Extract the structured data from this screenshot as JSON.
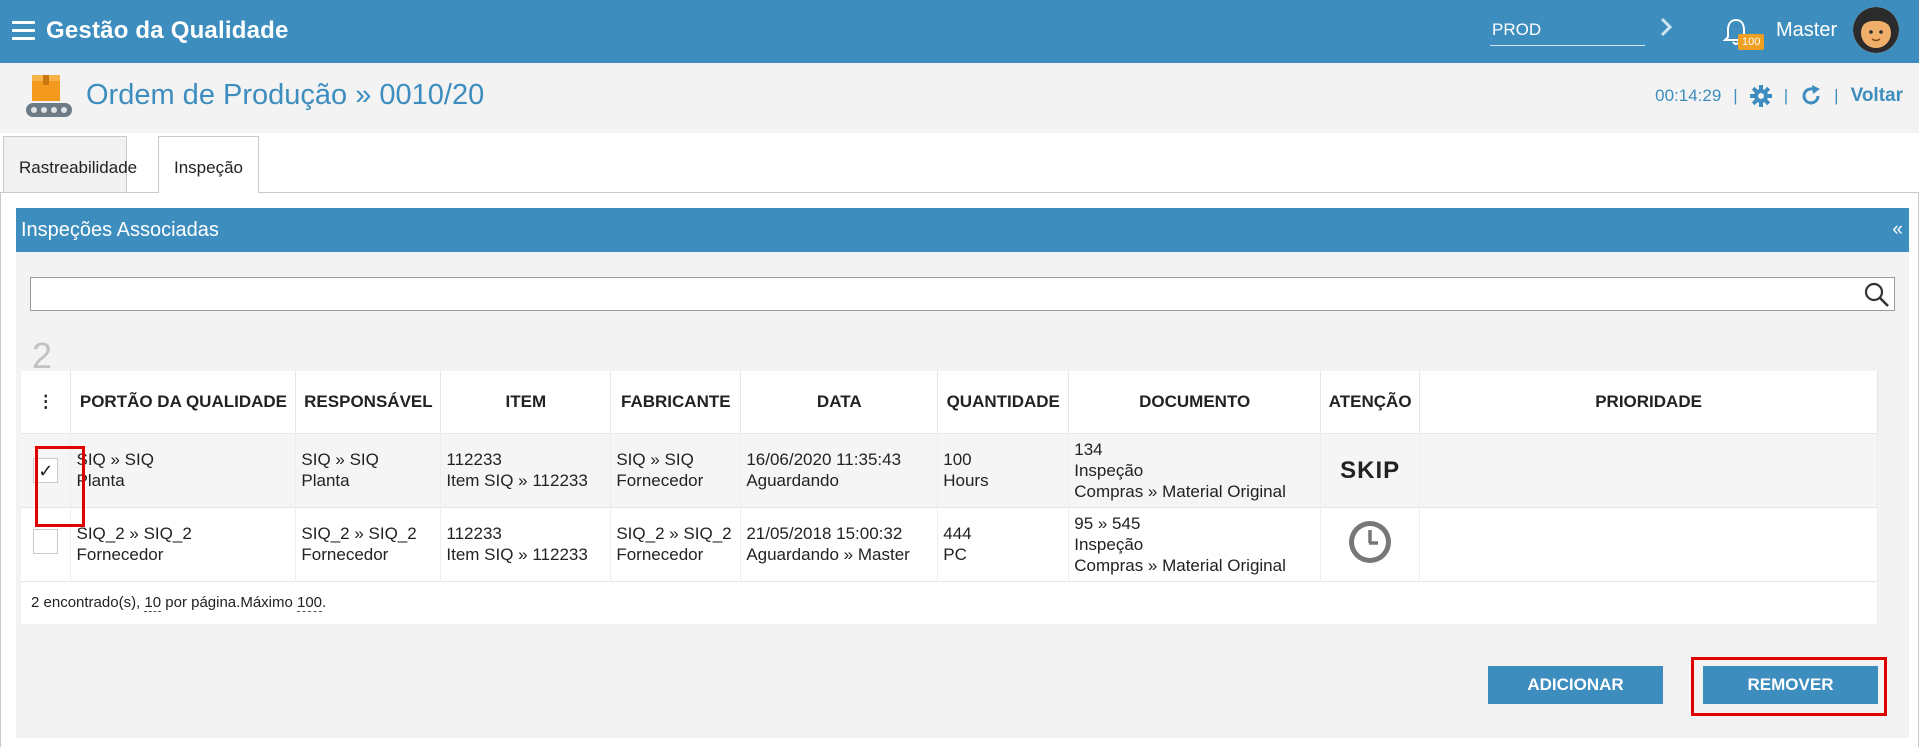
{
  "topbar": {
    "title": "Gestão da Qualidade",
    "env_value": "PROD",
    "notification_count": "100",
    "user_name": "Master"
  },
  "header": {
    "title": "Ordem de Produção » 0010/20",
    "timer": "00:14:29",
    "back_label": "Voltar"
  },
  "tabs": [
    {
      "label": "Rastreabilidade",
      "active": false
    },
    {
      "label": "Inspeção",
      "active": true
    }
  ],
  "panel": {
    "title": "Inspeções Associadas",
    "collapse_symbol": "«",
    "search_value": "",
    "count": "2"
  },
  "table": {
    "menu_symbol": "⋮",
    "columns": [
      "PORTÃO DA QUALIDADE",
      "RESPONSÁVEL",
      "ITEM",
      "FABRICANTE",
      "DATA",
      "QUANTIDADE",
      "DOCUMENTO",
      "ATENÇÃO",
      "PRIORIDADE"
    ],
    "rows": [
      {
        "checked": true,
        "check_mark": "✓",
        "gate": [
          "SIQ » SIQ",
          "Planta"
        ],
        "responsible": [
          "SIQ » SIQ",
          "Planta"
        ],
        "item": [
          "112233",
          "Item SIQ » 112233"
        ],
        "manufacturer": [
          "SIQ » SIQ",
          "Fornecedor"
        ],
        "date": [
          "16/06/2020 11:35:43",
          "Aguardando"
        ],
        "quantity": [
          "100",
          "Hours"
        ],
        "document": [
          "134",
          "Inspeção",
          "Compras » Material Original"
        ],
        "attention": "SKIP",
        "priority": ""
      },
      {
        "checked": false,
        "check_mark": "",
        "gate": [
          "SIQ_2 » SIQ_2",
          "Fornecedor"
        ],
        "responsible": [
          "SIQ_2 » SIQ_2",
          "Fornecedor"
        ],
        "item": [
          "112233",
          "Item SIQ » 112233"
        ],
        "manufacturer": [
          "SIQ_2 » SIQ_2",
          "Fornecedor"
        ],
        "date": [
          "21/05/2018 15:00:32",
          "Aguardando » Master"
        ],
        "quantity": [
          "444",
          "PC"
        ],
        "document": [
          "95 » 545",
          "Inspeção",
          "Compras » Material Original"
        ],
        "attention_icon": "clock-icon",
        "priority": ""
      }
    ],
    "footer": {
      "found_text": "2 encontrado(s), ",
      "per_page": "10",
      "per_page_text": " por página.Máximo ",
      "max": "100",
      "end": "."
    }
  },
  "buttons": {
    "add_label": "ADICIONAR",
    "remove_label": "REMOVER"
  },
  "colors": {
    "primary": "#3d8dbf",
    "highlight": "#e00000",
    "skip": "#2db84a",
    "badge": "#f0a020"
  }
}
